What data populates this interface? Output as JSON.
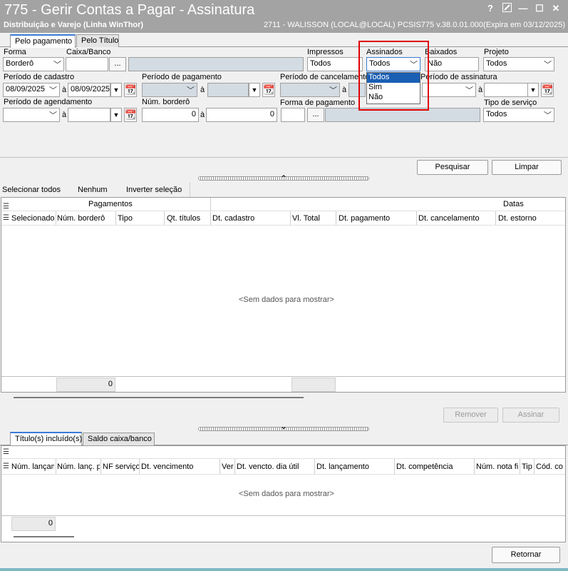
{
  "window": {
    "title": "775 - Gerir Contas a Pagar - Assinatura",
    "subtitle": "Distribuição e Varejo (Linha WinThor)",
    "user_info": "2711 - WALISSON (LOCAL@LOCAL)   PCSIS775  v.38.0.01.000(Expira em 03/12/2025)",
    "help": "?",
    "minimize": "—",
    "maximize": "☐",
    "close": "✕"
  },
  "tabs": [
    "Pelo pagamento",
    "Pelo Título"
  ],
  "form": {
    "forma": {
      "label": "Forma",
      "value": "Borderô"
    },
    "caixa_banco": {
      "label": "Caixa/Banco",
      "value": "",
      "ellipsis": "..."
    },
    "impressos": {
      "label": "Impressos",
      "value": "Todos"
    },
    "assinados": {
      "label": "Assinados",
      "value": "Todos",
      "options": [
        "Todos",
        "Sim",
        "Não"
      ],
      "selected": "Todos"
    },
    "baixados": {
      "label": "Baixados",
      "value": "Não"
    },
    "projeto": {
      "label": "Projeto",
      "value": "Todos"
    },
    "periodo_cadastro": {
      "label": "Período de cadastro",
      "from": "08/09/2025",
      "sep": "à",
      "to": "08/09/2025"
    },
    "periodo_pagamento": {
      "label": "Período de pagamento",
      "sep": "à"
    },
    "periodo_cancelamento": {
      "label": "Período de cancelamento",
      "sep": "à"
    },
    "periodo_assinatura": {
      "label": "Período de assinatura",
      "sep": "à"
    },
    "periodo_agendamento": {
      "label": "Período de agendamento",
      "sep": "à"
    },
    "num_bordero": {
      "label": "Núm. borderô",
      "from": "0",
      "sep": "à",
      "to": "0"
    },
    "forma_pagamento": {
      "label": "Forma de pagamento",
      "ellipsis": "..."
    },
    "tipo_servico": {
      "label": "Tipo de serviço",
      "value": "Todos"
    }
  },
  "buttons": {
    "pesquisar": "Pesquisar",
    "limpar": "Limpar",
    "remover": "Remover",
    "assinar": "Assinar",
    "retornar": "Retornar"
  },
  "selection_bar": [
    "Selecionar todos",
    "Nenhum",
    "Inverter seleção"
  ],
  "grid1": {
    "group_headers": {
      "pagamentos": "Pagamentos",
      "datas": "Datas"
    },
    "columns": [
      "Selecionado",
      "Núm. borderô",
      "Tipo",
      "Qt. títulos",
      "Dt. cadastro",
      "Vl. Total",
      "Dt. pagamento",
      "Dt. cancelamento",
      "Dt. estorno"
    ],
    "empty_text": "<Sem dados para mostrar>",
    "footer_total": "0"
  },
  "bottom_tabs": [
    "Título(s) incluído(s)",
    "Saldo caixa/banco"
  ],
  "grid2": {
    "columns": [
      "Núm. lançam",
      "Núm. lanç. p",
      "NF serviço",
      "Dt. vencimento",
      "Ver",
      "Dt. vencto. dia útil",
      "Dt. lançamento",
      "Dt. competência",
      "Núm. nota fi",
      "Tip",
      "Cód. co"
    ],
    "empty_text": "<Sem dados para mostrar>",
    "footer_total": "0"
  },
  "icons": {
    "chevron": "﹀",
    "calendar": "📆",
    "splitter_up": "⌃",
    "splitter_down": "⌄",
    "rowmenu": "☰"
  },
  "colors": {
    "accent": "#1a5fb4",
    "highlight_box": "#e00000",
    "title_bar": "#a3a3a3"
  }
}
